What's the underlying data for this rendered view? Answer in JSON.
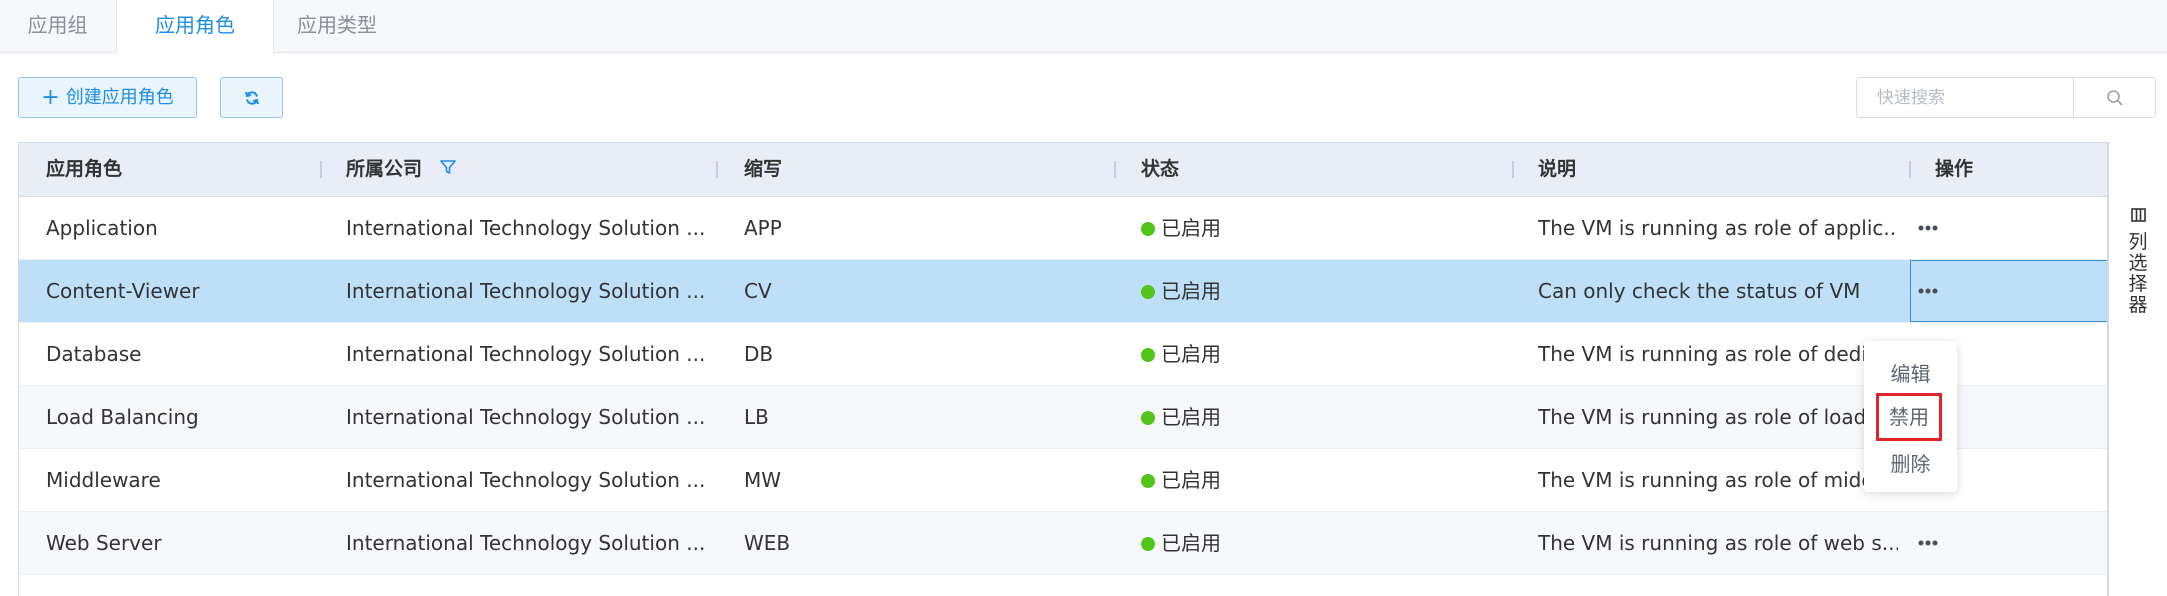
{
  "tabs": [
    {
      "label": "应用组",
      "active": false
    },
    {
      "label": "应用角色",
      "active": true
    },
    {
      "label": "应用类型",
      "active": false
    }
  ],
  "toolbar": {
    "create_label": "创建应用角色",
    "create_icon": "plus-icon",
    "refresh_icon": "refresh-icon"
  },
  "search": {
    "placeholder": "快速搜索",
    "value": "",
    "icon": "search-icon"
  },
  "table": {
    "columns": [
      {
        "label": "应用角色"
      },
      {
        "label": "所属公司",
        "filter_icon": "filter-icon"
      },
      {
        "label": "缩写"
      },
      {
        "label": "状态"
      },
      {
        "label": "说明"
      },
      {
        "label": "操作"
      }
    ],
    "rows": [
      {
        "role": "Application",
        "company": "International Technology Solution ...",
        "abbr": "APP",
        "status": "已启用",
        "desc": "The VM is running as role of applic...",
        "selected": false
      },
      {
        "role": "Content-Viewer",
        "company": "International Technology Solution ...",
        "abbr": "CV",
        "status": "已启用",
        "desc": "Can only check the status of VM",
        "selected": true
      },
      {
        "role": "Database",
        "company": "International Technology Solution ...",
        "abbr": "DB",
        "status": "已启用",
        "desc": "The VM is running as role of dedica",
        "selected": false
      },
      {
        "role": "Load Balancing",
        "company": "International Technology Solution ...",
        "abbr": "LB",
        "status": "已启用",
        "desc": "The VM is running as role of load b",
        "selected": false
      },
      {
        "role": "Middleware",
        "company": "International Technology Solution ...",
        "abbr": "MW",
        "status": "已启用",
        "desc": "The VM is running as role of middl.",
        "selected": false
      },
      {
        "role": "Web Server",
        "company": "International Technology Solution ...",
        "abbr": "WEB",
        "status": "已启用",
        "desc": "The VM is running as role of web s...",
        "selected": false
      }
    ],
    "status_color": "#52c41a",
    "more_icon": "more-icon"
  },
  "column_picker": {
    "label": "列选择器",
    "icon": "columns-icon"
  },
  "action_menu": {
    "items": [
      {
        "label": "编辑",
        "highlighted": false
      },
      {
        "label": "禁用",
        "highlighted": true
      },
      {
        "label": "删除",
        "highlighted": false
      }
    ]
  },
  "colors": {
    "accent": "#1e8ee6",
    "selected_row": "#bde0f8",
    "header_bg": "#e8edf7",
    "highlight_box": "#e0242b"
  }
}
